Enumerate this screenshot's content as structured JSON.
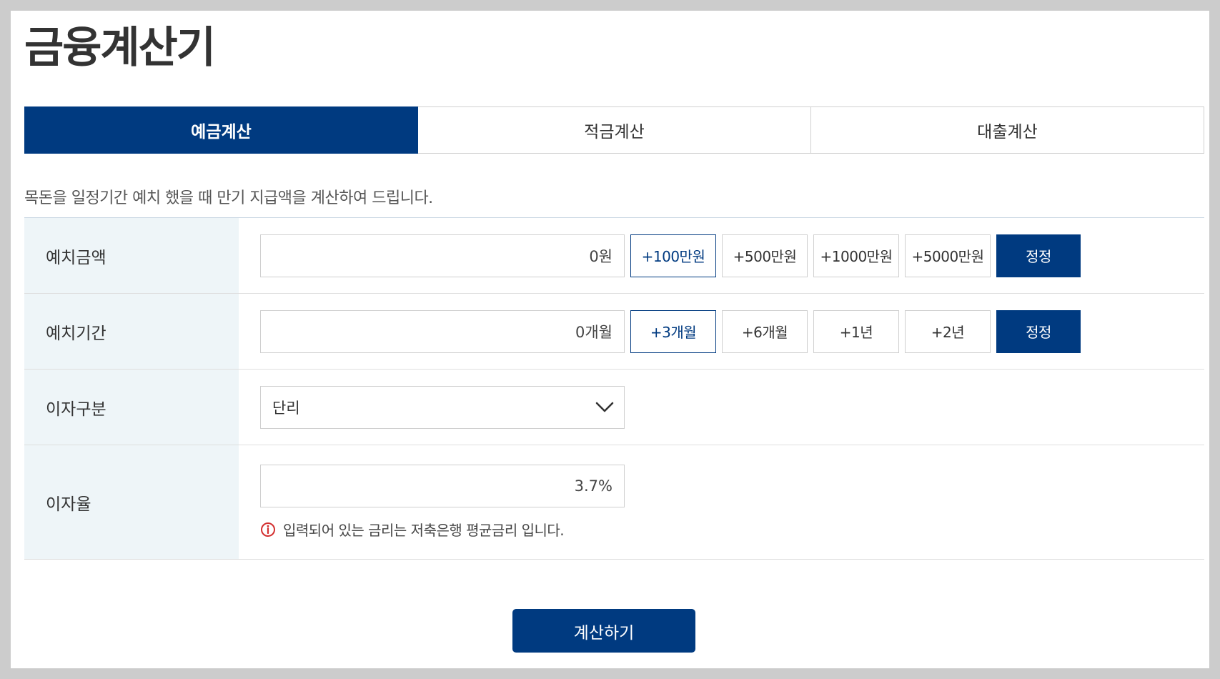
{
  "page": {
    "title": "금융계산기"
  },
  "tabs": [
    {
      "label": "예금계산",
      "active": true
    },
    {
      "label": "적금계산",
      "active": false
    },
    {
      "label": "대출계산",
      "active": false
    }
  ],
  "description": "목돈을 일정기간 예치 했을 때 만기 지급액을 계산하여 드립니다.",
  "form": {
    "amount": {
      "label": "예치금액",
      "value": "0원",
      "chips": [
        "+100만원",
        "+500만원",
        "+1000만원",
        "+5000만원"
      ],
      "reset_label": "정정"
    },
    "period": {
      "label": "예치기간",
      "value": "0개월",
      "chips": [
        "+3개월",
        "+6개월",
        "+1년",
        "+2년"
      ],
      "reset_label": "정정"
    },
    "interest_type": {
      "label": "이자구분",
      "selected": "단리"
    },
    "rate": {
      "label": "이자율",
      "value": "3.7%",
      "notice": "입력되어 있는 금리는 저축은행 평균금리 입니다."
    }
  },
  "calculate_label": "계산하기",
  "colors": {
    "primary": "#003a80",
    "label_bg": "#eef5f8",
    "notice_icon": "#d32f2f"
  }
}
